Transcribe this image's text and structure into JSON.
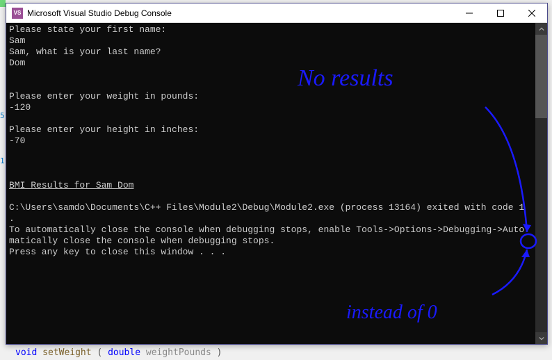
{
  "window": {
    "title": "Microsoft Visual Studio Debug Console",
    "icon_label": "VS"
  },
  "console": {
    "lines": {
      "l0": "Please state your first name:",
      "l1": "Sam",
      "l2": "Sam, what is your last name?",
      "l3": "Dom",
      "l4": "Please enter your weight in pounds:",
      "l5": "-120",
      "l6": "Please enter your height in inches:",
      "l7": "-70",
      "l8": "BMI Results for Sam Dom",
      "l9": "C:\\Users\\samdo\\Documents\\C++ Files\\Module2\\Debug\\Module2.exe (process 13164) exited with code 1",
      "l10": ".",
      "l11": "To automatically close the console when debugging stops, enable Tools->Options->Debugging->Auto",
      "l12": "matically close the console when debugging stops.",
      "l13": "Press any key to close this window . . ."
    }
  },
  "annotations": {
    "a1": "No results",
    "a2": "instead of 0"
  },
  "gutter": {
    "m1": "5",
    "m2": "1"
  },
  "bgcode": {
    "kw_void": "void",
    "fn_name": "setWeight",
    "paren_open": "(",
    "type_double": "double",
    "param": " weightPounds",
    "paren_close": ")"
  }
}
